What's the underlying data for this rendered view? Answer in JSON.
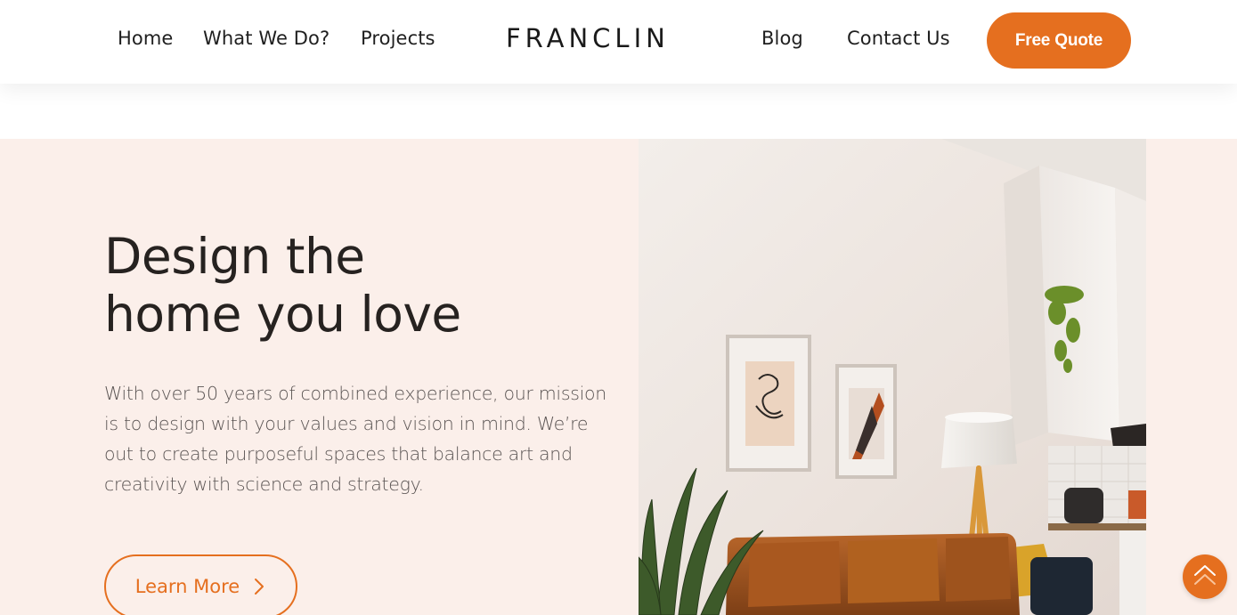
{
  "nav": {
    "items": [
      {
        "label": "Home"
      },
      {
        "label": "What We Do?"
      },
      {
        "label": "Projects"
      },
      {
        "label": "Blog"
      },
      {
        "label": "Contact Us"
      }
    ],
    "logo": "FRANCLIN",
    "cta_label": "Free Quote"
  },
  "hero": {
    "title_line1": "Design the",
    "title_line2": "home you love",
    "description": "With over 50 years of combined experience, our mission is to design with your values and vision in mind. We’re out to create purposeful spaces that balance art and creativity with science and strategy.",
    "button_label": "Learn More",
    "image_icon": "living-room-photo"
  },
  "icons": {
    "learn_more": "chevron-right-icon",
    "back_to_top": "double-chevron-up-icon"
  },
  "colors": {
    "accent": "#e56f1f",
    "hero_background": "#fbefea",
    "text_dark": "#262220",
    "text_body": "#5a5453"
  }
}
